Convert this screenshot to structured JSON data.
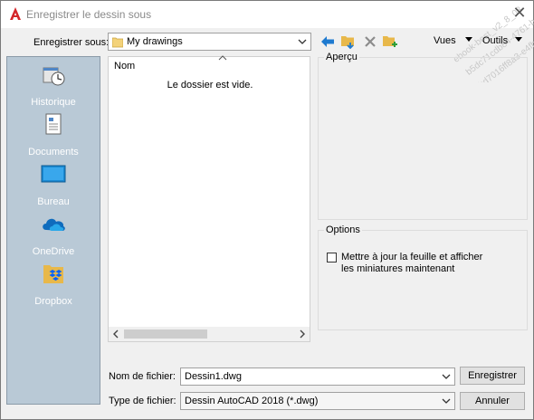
{
  "window": {
    "title": "Enregistrer le dessin sous",
    "close_glyph": "✕",
    "watermark": [
      "ebook-best_v2_8_03",
      "b5dc71cdb84-4761-b",
      "bd7016ff8a3-e4fb2fb"
    ]
  },
  "save_in": {
    "label_prefix": "Enregistrer sous:",
    "value": "My drawings"
  },
  "toolbar": {
    "back_icon": "back-arrow-icon",
    "up_folder_icon": "up-folder-icon",
    "delete_icon": "delete-x-icon",
    "new_folder_icon": "new-folder-icon",
    "views_label": "Vues",
    "tools_label": "Outils"
  },
  "places": [
    {
      "label": "Historique",
      "icon": "history-icon"
    },
    {
      "label": "Documents",
      "icon": "documents-icon"
    },
    {
      "label": "Bureau",
      "icon": "desktop-icon"
    },
    {
      "label": "OneDrive",
      "icon": "onedrive-icon"
    },
    {
      "label": "Dropbox",
      "icon": "dropbox-icon"
    }
  ],
  "filelist": {
    "column_header": "Nom",
    "empty_message": "Le dossier est vide."
  },
  "preview": {
    "legend": "Aperçu"
  },
  "options": {
    "legend": "Options",
    "checkbox_label_line1": "Mettre à jour la feuille et afficher",
    "checkbox_label_line2": "les miniatures maintenant",
    "checked": false
  },
  "filename": {
    "label": "Nom de fichier:",
    "value": "Dessin1.dwg"
  },
  "filetype": {
    "label": "Type de fichier:",
    "value": "Dessin AutoCAD 2018 (*.dwg)"
  },
  "buttons": {
    "save": "Enregistrer",
    "cancel": "Annuler"
  },
  "colors": {
    "accent_blue": "#1e7ad0",
    "folder_yellow": "#e8b84a",
    "places_bg": "#b9c9d6",
    "autocad_red": "#d4262a"
  }
}
